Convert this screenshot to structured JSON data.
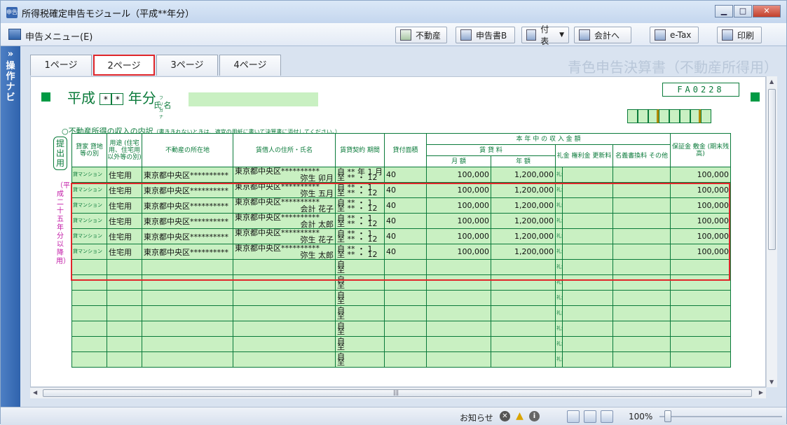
{
  "window": {
    "title": "所得税確定申告モジュール（平成**年分）",
    "app_icon": "申告"
  },
  "menu": {
    "label": "申告メニュー(E)"
  },
  "toolbar": {
    "fudousan": "不動産",
    "shinkokusho_b": "申告書B",
    "fuhyo": "付表",
    "kaikei": "会計へ",
    "etax": "e-Tax",
    "print": "印刷"
  },
  "nav": {
    "label": "»操作ナビ"
  },
  "tabs": [
    "1ページ",
    "2ページ",
    "3ページ",
    "4ページ"
  ],
  "selected_tab": "2ページ",
  "form_title": "青色申告決算書（不動産所得用）",
  "form": {
    "heisei": "平成",
    "year_box1": "*",
    "year_box2": "*",
    "nenbun": "年分",
    "furigana": "フリガナ",
    "shimei": "氏 名",
    "code": "FA0228",
    "subtitle": "○不動産所得の収入の内訳",
    "subtitle_note": "（書ききれないときは、適宜の用紙に書いて決算書に添付してください。）",
    "side_label": "提出用",
    "side_note": "（平成二十五年分以降用）"
  },
  "headers": {
    "kashiya": "貸家 貸地 等の別",
    "yoto": "用途 (住宅用、住宅用以外等の別)",
    "shozaichi": "不動産の所在地",
    "chinshakunin": "賃借人の住所・氏名",
    "keiyaku": "賃貸契約 期間",
    "menseki": "貸付面積",
    "shunyu": "本 年 中 の 収 入 金 額",
    "getsugaku": "月 額",
    "nengaku": "年 額",
    "chinryo": "賃 貸 料",
    "reikin": "礼金 権利金 更新料",
    "meigi": "名義書換料 その他",
    "hoshokin": "保証金 敷金 (期末残高)",
    "jiri": "自",
    "itaru": "至",
    "nen": "年",
    "tsuki": "月",
    "heibei": "平方メートル",
    "en": "円"
  },
  "rows": [
    {
      "kashiya": "貸マンション",
      "yoto": "住宅用",
      "shozaichi": "東京都中央区**********",
      "addr": "東京都中央区**********",
      "tenant": "弥生 卯月",
      "from": "** 年 1 月",
      "to": "** ・ 12",
      "area": "40",
      "monthly": "100,000",
      "annual": "1,200,000",
      "deposit": "100,000"
    },
    {
      "kashiya": "貸マンション",
      "yoto": "住宅用",
      "shozaichi": "東京都中央区**********",
      "addr": "東京都中央区**********",
      "tenant": "弥生 五月",
      "from": "** ・ 1",
      "to": "** ・ 12",
      "area": "40",
      "monthly": "100,000",
      "annual": "1,200,000",
      "deposit": "100,000"
    },
    {
      "kashiya": "貸マンション",
      "yoto": "住宅用",
      "shozaichi": "東京都中央区**********",
      "addr": "東京都中央区**********",
      "tenant": "会計 花子",
      "from": "** ・ 1",
      "to": "** ・ 12",
      "area": "40",
      "monthly": "100,000",
      "annual": "1,200,000",
      "deposit": "100,000"
    },
    {
      "kashiya": "貸マンション",
      "yoto": "住宅用",
      "shozaichi": "東京都中央区**********",
      "addr": "東京都中央区**********",
      "tenant": "会計 太郎",
      "from": "** ・ 1",
      "to": "** ・ 12",
      "area": "40",
      "monthly": "100,000",
      "annual": "1,200,000",
      "deposit": "100,000"
    },
    {
      "kashiya": "貸マンション",
      "yoto": "住宅用",
      "shozaichi": "東京都中央区**********",
      "addr": "東京都中央区**********",
      "tenant": "弥生 花子",
      "from": "** ・ 1",
      "to": "** ・ 12",
      "area": "40",
      "monthly": "100,000",
      "annual": "1,200,000",
      "deposit": "100,000"
    },
    {
      "kashiya": "貸マンション",
      "yoto": "住宅用",
      "shozaichi": "東京都中央区**********",
      "addr": "東京都中央区**********",
      "tenant": "弥生 太郎",
      "from": "** ・ 1",
      "to": "** ・ 12",
      "area": "40",
      "monthly": "100,000",
      "annual": "1,200,000",
      "deposit": "100,000"
    }
  ],
  "empty_rows": 7,
  "status": {
    "notice": "お知らせ",
    "zoom": "100%"
  },
  "colors": {
    "form_green": "#0a7a3a",
    "field_bg": "#c9f0c2",
    "highlight_red": "#e0262a",
    "nav_blue": "#2f63ad"
  }
}
